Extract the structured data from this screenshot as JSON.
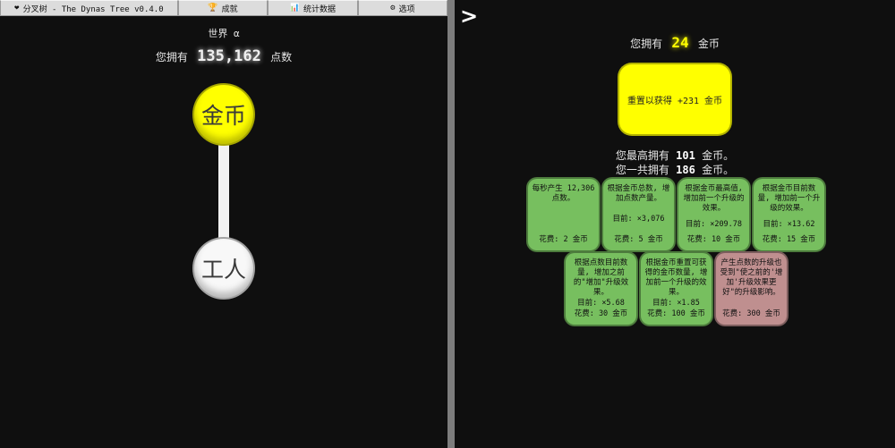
{
  "tabs": [
    {
      "icon": "❤",
      "label": "分叉树 - The Dynas Tree v0.4.0"
    },
    {
      "icon": "🏆",
      "label": "成就"
    },
    {
      "icon": "📊",
      "label": "统计数据"
    },
    {
      "icon": "⚙",
      "label": "选项"
    }
  ],
  "world": "世界 α",
  "points": {
    "prefix": "您拥有",
    "value": "135,162",
    "suffix": "点数"
  },
  "tree": {
    "coin_node": "金币",
    "worker_node": "工人"
  },
  "nav": {
    "arrow": ">"
  },
  "coins": {
    "prefix": "您拥有",
    "value": "24",
    "suffix": "金币"
  },
  "reset": {
    "label": "重置以获得 +231 金币"
  },
  "best": {
    "line1_prefix": "您最高拥有",
    "line1_value": "101",
    "line1_suffix": "金币。",
    "line2_prefix": "您一共拥有",
    "line2_value": "186",
    "line2_suffix": "金币。"
  },
  "upgrades": [
    {
      "desc": "每秒产生 12,306 点数。",
      "current": "",
      "cost": "花费: 2 金币",
      "state": "bought"
    },
    {
      "desc": "根据金币总数, 增加点数产量。",
      "current": "目前: ×3,076",
      "cost": "花费: 5 金币",
      "state": "bought"
    },
    {
      "desc": "根据金币最高值, 增加前一个升级的效果。",
      "current": "目前: ×209.78",
      "cost": "花费: 10 金币",
      "state": "bought"
    },
    {
      "desc": "根据金币目前数量, 增加前一个升级的效果。",
      "current": "目前: ×13.62",
      "cost": "花费: 15 金币",
      "state": "bought"
    },
    {
      "desc": "根据点数目前数量, 增加之前的\"增加\"升级效果。",
      "current": "目前: ×5.68",
      "cost": "花费: 30 金币",
      "state": "bought"
    },
    {
      "desc": "根据金币重置可获得的金币数量, 增加前一个升级的效果。",
      "current": "目前: ×1.85",
      "cost": "花费: 100 金币",
      "state": "bought"
    },
    {
      "desc": "产生点数的升级也受到\"使之前的'增加'升级效果更好\"的升级影响。",
      "current": "",
      "cost": "花费: 300 金币",
      "state": "locked"
    }
  ],
  "colors": {
    "coin": "#ffff00",
    "bought": "#77bf5f",
    "locked": "#bf8f8f",
    "background": "#0f0f0f"
  }
}
